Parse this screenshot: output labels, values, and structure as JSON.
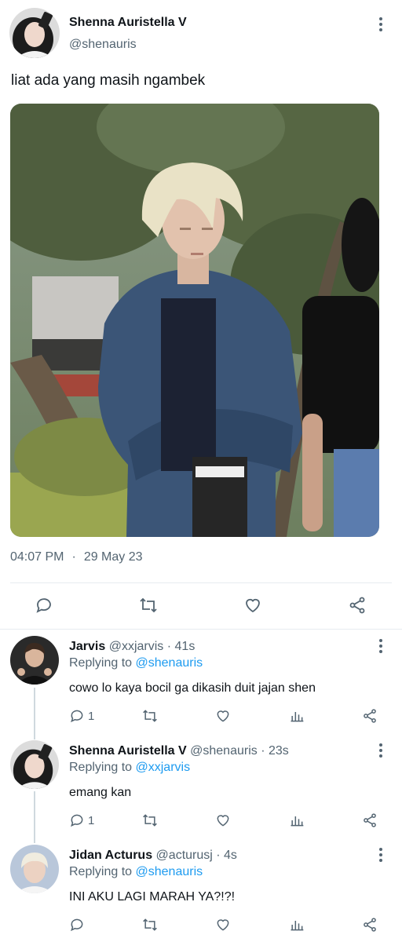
{
  "main_tweet": {
    "display_name": "Shenna Auristella V",
    "handle": "@shenauris",
    "text": "liat ada yang masih ngambek",
    "time": "04:07 PM",
    "separator": "·",
    "date": "29 May 23"
  },
  "replies": [
    {
      "display_name": "Jarvis",
      "handle_time": "@xxjarvis · 41s",
      "replying_prefix": "Replying to",
      "replying_to": "@shenauris",
      "text": "cowo lo kaya bocil ga dikasih duit jajan shen",
      "reply_count": "1"
    },
    {
      "display_name": "Shenna Auristella V",
      "handle_time": "@shenauris · 23s",
      "replying_prefix": "Replying to",
      "replying_to": "@xxjarvis",
      "text": "emang kan",
      "reply_count": "1"
    },
    {
      "display_name": "Jidan Acturus",
      "handle_time": "@acturusj · 4s",
      "replying_prefix": "Replying to",
      "replying_to": "@shenauris",
      "text": "INI AKU LAGI MARAH YA?!?!",
      "reply_count": ""
    }
  ],
  "colors": {
    "text": "#0f1419",
    "secondary": "#536471",
    "link": "#1d9bf0",
    "divider": "#e6ecf0"
  },
  "icons": [
    "reply-icon",
    "retweet-icon",
    "like-icon",
    "analytics-icon",
    "share-icon",
    "more-icon"
  ]
}
